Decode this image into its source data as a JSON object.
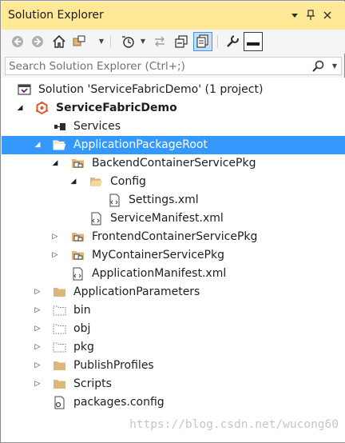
{
  "window": {
    "title": "Solution Explorer",
    "pin_icon": "pin-icon",
    "close_icon": "close-icon",
    "dropdown_icon": "window-position-dropdown-icon"
  },
  "toolbar": {
    "icons": [
      "back-icon",
      "forward-icon",
      "home-icon",
      "switch-views-icon",
      "pending-changes-filter-icon",
      "sync-icon",
      "collapse-all-icon",
      "show-all-files-icon",
      "properties-icon",
      "preview-icon"
    ]
  },
  "search": {
    "placeholder": "Search Solution Explorer (Ctrl+;)"
  },
  "tree": {
    "solution": "Solution 'ServiceFabricDemo' (1 project)",
    "project": "ServiceFabricDemo",
    "services": "Services",
    "app_package_root": "ApplicationPackageRoot",
    "backend_pkg": "BackendContainerServicePkg",
    "config": "Config",
    "settings": "Settings.xml",
    "service_manifest": "ServiceManifest.xml",
    "frontend_pkg": "FrontendContainerServicePkg",
    "my_pkg": "MyContainerServicePkg",
    "app_manifest": "ApplicationManifest.xml",
    "app_params": "ApplicationParameters",
    "bin": "bin",
    "obj": "obj",
    "pkg": "pkg",
    "publish_profiles": "PublishProfiles",
    "scripts": "Scripts",
    "packages_config": "packages.config"
  },
  "watermark": "https://blog.csdn.net/wucong60",
  "colors": {
    "title_bar": "#ffe896",
    "selection": "#3399ff",
    "folder": "#dcb67a"
  }
}
